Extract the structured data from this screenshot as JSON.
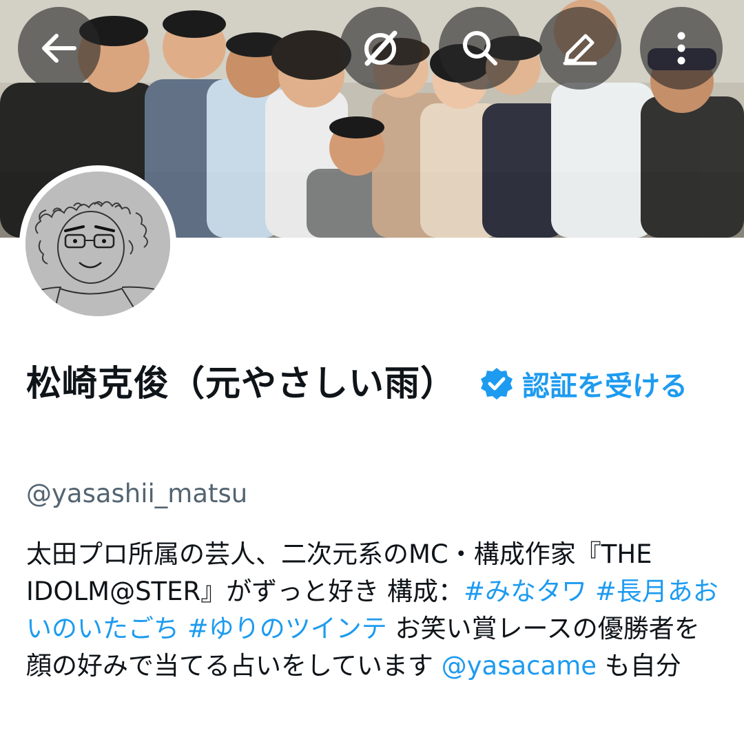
{
  "colors": {
    "accent": "#1d9bf0",
    "text_primary": "#0f1419",
    "text_secondary": "#536471",
    "header_button_bg": "rgba(40,40,40,0.62)"
  },
  "header": {
    "buttons": [
      {
        "icon": "back-arrow-icon"
      },
      {
        "icon": "grok-icon"
      },
      {
        "icon": "search-icon"
      },
      {
        "icon": "edit-icon"
      },
      {
        "icon": "more-vertical-icon"
      }
    ]
  },
  "profile": {
    "display_name": "松崎克俊（元やさしい雨）",
    "verified_badge_icon": "verified-badge-icon",
    "verify_cta": "認証を受ける",
    "handle": "@yasashii_matsu",
    "bio": {
      "t1": "太田プロ所属の芸人、二次元系のMC・構成作家『THE IDOLM@STER』がずっと好き 構成：",
      "h1": "#みなタワ",
      "s1": " ",
      "h2": "#長月あおいのいたごち",
      "s2": " ",
      "h3": "#ゆりのツインテ",
      "t2": " お笑い賞レースの優勝者を顔の好みで当てる占いをしています ",
      "mention": "@yasacame",
      "t3": " も自分"
    }
  }
}
